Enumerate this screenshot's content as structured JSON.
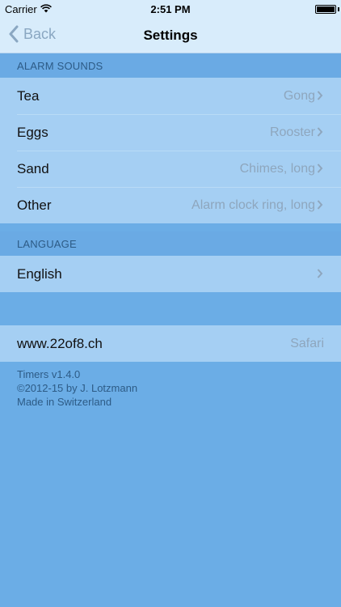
{
  "status_bar": {
    "carrier": "Carrier",
    "time": "2:51 PM"
  },
  "navbar": {
    "back_label": "Back",
    "title": "Settings"
  },
  "sections": {
    "alarm_sounds": {
      "header": "ALARM SOUNDS",
      "rows": [
        {
          "label": "Tea",
          "value": "Gong"
        },
        {
          "label": "Eggs",
          "value": "Rooster"
        },
        {
          "label": "Sand",
          "value": "Chimes, long"
        },
        {
          "label": "Other",
          "value": "Alarm clock ring, long"
        }
      ]
    },
    "language": {
      "header": "LANGUAGE",
      "rows": [
        {
          "label": "English",
          "value": ""
        }
      ]
    },
    "website": {
      "rows": [
        {
          "label": "www.22of8.ch",
          "value": "Safari"
        }
      ]
    }
  },
  "footer": {
    "line1": "Timers v1.4.0",
    "line2": "©2012-15 by J. Lotzmann",
    "line3": "Made in Switzerland"
  },
  "colors": {
    "background": "#6badE6",
    "bar": "#d8ecfb",
    "row": "#a5cff3",
    "section_text": "#2d5b86",
    "value_text": "#8ea6bd"
  },
  "icons": [
    "wifi-icon",
    "battery-icon",
    "back-chevron-icon",
    "chevron-right-icon"
  ]
}
